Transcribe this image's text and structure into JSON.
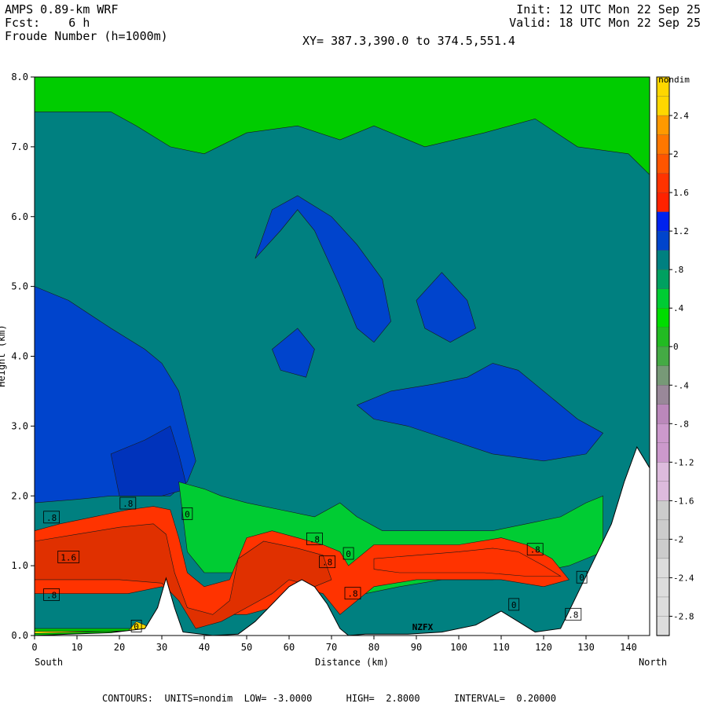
{
  "header": {
    "model": "AMPS 0.89-km WRF",
    "fcst": "Fcst:    6 h",
    "field": "Froude Number (h=1000m)",
    "init": "Init: 12 UTC Mon 22 Sep 25",
    "valid": "Valid: 18 UTC Mon 22 Sep 25",
    "xy": "XY= 387.3,390.0 to 374.5,551.4"
  },
  "footer": {
    "text": "CONTOURS:  UNITS=nondim  LOW= -3.0000      HIGH=  2.8000      INTERVAL=  0.20000"
  },
  "chart_data": {
    "type": "heatmap",
    "title": "Froude Number (h=1000m)",
    "xlabel": "Distance (km)",
    "ylabel": "Height (km)",
    "x_left_label": "South",
    "x_right_label": "North",
    "xlim": [
      0,
      145
    ],
    "ylim": [
      0.0,
      8.0
    ],
    "xticks": [
      "0",
      "10",
      "20",
      "30",
      "40",
      "50",
      "60",
      "70",
      "80",
      "90",
      "100",
      "110",
      "120",
      "130",
      "140"
    ],
    "yticks": [
      "0.0",
      "1.0",
      "2.0",
      "3.0",
      "4.0",
      "5.0",
      "6.0",
      "7.0",
      "8.0"
    ],
    "colorbar": {
      "unit": "nondim",
      "ticks": [
        "2.4",
        "2",
        "1.6",
        "1.2",
        ".8",
        ".4",
        "0",
        "-.4",
        "-.8",
        "-1.2",
        "-1.6",
        "-2",
        "-2.4",
        "-2.8"
      ],
      "min": -3.0,
      "max": 2.8,
      "interval": 0.2
    },
    "station": "NZFX",
    "contour_labels": [
      {
        "text": ".8",
        "x": 4,
        "y": 1.69
      },
      {
        "text": ".8",
        "x": 22,
        "y": 1.89
      },
      {
        "text": "1.6",
        "x": 8,
        "y": 1.12
      },
      {
        "text": ".8",
        "x": 4,
        "y": 0.58
      },
      {
        "text": "0",
        "x": 24,
        "y": 0.13
      },
      {
        "text": "0",
        "x": 36,
        "y": 1.74
      },
      {
        "text": ".8",
        "x": 66,
        "y": 1.38
      },
      {
        "text": ".8",
        "x": 69,
        "y": 1.05
      },
      {
        "text": "0",
        "x": 74,
        "y": 1.17
      },
      {
        "text": ".8",
        "x": 75,
        "y": 0.6
      },
      {
        "text": "0",
        "x": 113,
        "y": 0.44
      },
      {
        "text": ".8",
        "x": 118,
        "y": 1.23
      },
      {
        "text": "0",
        "x": 129,
        "y": 0.83
      },
      {
        "text": ".8",
        "x": 127,
        "y": 0.3
      }
    ],
    "terrain": [
      [
        0,
        0.0
      ],
      [
        8,
        0.02
      ],
      [
        18,
        0.04
      ],
      [
        26,
        0.1
      ],
      [
        29,
        0.4
      ],
      [
        31,
        0.82
      ],
      [
        33,
        0.4
      ],
      [
        35,
        0.05
      ],
      [
        42,
        0.0
      ],
      [
        48,
        0.02
      ],
      [
        52,
        0.2
      ],
      [
        56,
        0.45
      ],
      [
        60,
        0.7
      ],
      [
        63,
        0.8
      ],
      [
        66,
        0.7
      ],
      [
        69,
        0.45
      ],
      [
        72,
        0.1
      ],
      [
        74,
        0.0
      ],
      [
        78,
        0.02
      ],
      [
        88,
        0.02
      ],
      [
        96,
        0.05
      ],
      [
        104,
        0.15
      ],
      [
        110,
        0.35
      ],
      [
        114,
        0.2
      ],
      [
        118,
        0.05
      ],
      [
        124,
        0.1
      ],
      [
        128,
        0.6
      ],
      [
        132,
        1.1
      ],
      [
        136,
        1.6
      ],
      [
        139,
        2.2
      ],
      [
        142,
        2.7
      ],
      [
        145,
        2.4
      ]
    ]
  }
}
